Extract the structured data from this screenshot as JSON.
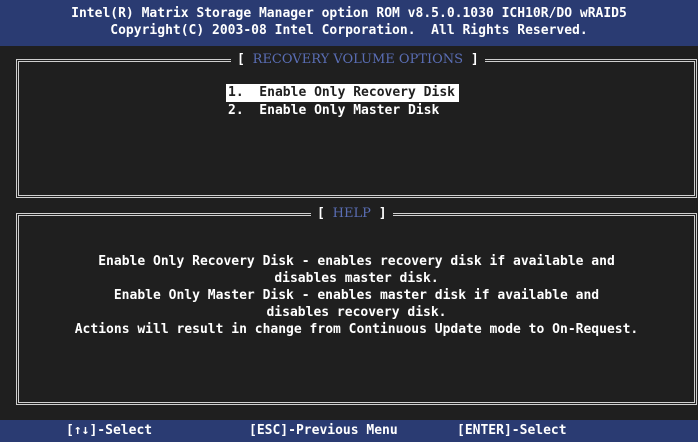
{
  "header": {
    "line1": "Intel(R) Matrix Storage Manager option ROM v8.5.0.1030 ICH10R/DO wRAID5",
    "line2": "Copyright(C) 2003-08 Intel Corporation.  All Rights Reserved."
  },
  "recovery_panel": {
    "title_prefix": "[ ",
    "title": "RECOVERY VOLUME OPTIONS",
    "title_suffix": " ]",
    "items": [
      {
        "label": "1.  Enable Only Recovery Disk",
        "selected": true
      },
      {
        "label": "2.  Enable Only Master Disk",
        "selected": false
      }
    ]
  },
  "help_panel": {
    "title_prefix": "[ ",
    "title": "HELP",
    "title_suffix": " ]",
    "lines": [
      "Enable Only Recovery Disk - enables recovery disk if available and",
      "disables master disk.",
      "Enable Only Master Disk - enables master disk if available and",
      "disables recovery disk.",
      "Actions will result in change from Continuous Update mode to On-Request."
    ]
  },
  "footer": {
    "select_arrows": "[↑↓]-Select",
    "esc": "[ESC]-Previous Menu",
    "enter": "[ENTER]-Select"
  },
  "colors": {
    "background": "#1f1f1f",
    "bar": "#2a3b72",
    "title_accent": "#5a6eb5",
    "text": "#ffffff"
  }
}
